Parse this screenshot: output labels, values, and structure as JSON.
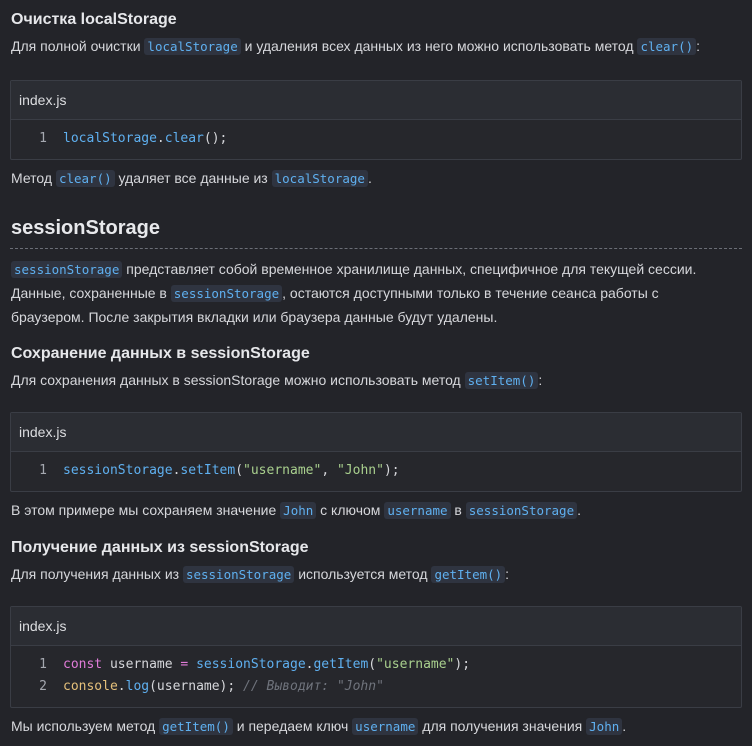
{
  "sec_clear": {
    "heading": "Очистка localStorage",
    "p1_a": "Для полной очистки ",
    "p1_code1": "localStorage",
    "p1_b": " и удаления всех данных из него можно использовать метод ",
    "p1_code2": "clear()",
    "p1_c": ":",
    "block_title": "index.js",
    "line1": {
      "num": "1",
      "id": "localStorage",
      "dot": ".",
      "fn": "clear",
      "rest": "();"
    },
    "p2_a": "Метод ",
    "p2_code1": "clear()",
    "p2_b": " удаляет все данные из ",
    "p2_code2": "localStorage",
    "p2_c": "."
  },
  "sec_session": {
    "heading": "sessionStorage",
    "p1_code1": "sessionStorage",
    "p1_a": " представляет собой временное хранилище данных, специфичное для текущей сессии.",
    "p2_a": "Данные, сохраненные в ",
    "p2_code1": "sessionStorage",
    "p2_b": ", остаются доступными только в течение сеанса работы с",
    "p3": "браузером. После закрытия вкладки или браузера данные будут удалены."
  },
  "sec_save": {
    "heading": "Сохранение данных в sessionStorage",
    "p1_a": "Для сохранения данных в sessionStorage можно использовать метод ",
    "p1_code1": "setItem()",
    "p1_b": ":",
    "block_title": "index.js",
    "line1": {
      "num": "1",
      "id": "sessionStorage",
      "dot": ".",
      "fn": "setItem",
      "open": "(",
      "s1": "\"username\"",
      "comma": ", ",
      "s2": "\"John\"",
      "close": ");"
    },
    "p2_a": "В этом примере мы сохраняем значение ",
    "p2_code1": "John",
    "p2_b": " с ключом ",
    "p2_code2": "username",
    "p2_c": " в ",
    "p2_code3": "sessionStorage",
    "p2_d": "."
  },
  "sec_get": {
    "heading": "Получение данных из sessionStorage",
    "p1_a": "Для получения данных из ",
    "p1_code1": "sessionStorage",
    "p1_b": " используется метод ",
    "p1_code2": "getItem()",
    "p1_c": ":",
    "block_title": "index.js",
    "line1": {
      "num": "1",
      "kw": "const",
      "var": " username ",
      "eq": "=",
      "sp": " ",
      "id": "sessionStorage",
      "dot": ".",
      "fn": "getItem",
      "open": "(",
      "s1": "\"username\"",
      "close": ");"
    },
    "line2": {
      "num": "2",
      "obj": "console",
      "dot": ".",
      "fn": "log",
      "args": "(username); ",
      "comment": "// Выводит: \"John\""
    },
    "p2_a": "Мы используем метод ",
    "p2_code1": "getItem()",
    "p2_b": " и передаем ключ ",
    "p2_code2": "username",
    "p2_c": " для получения значения ",
    "p2_code3": "John",
    "p2_d": "."
  }
}
